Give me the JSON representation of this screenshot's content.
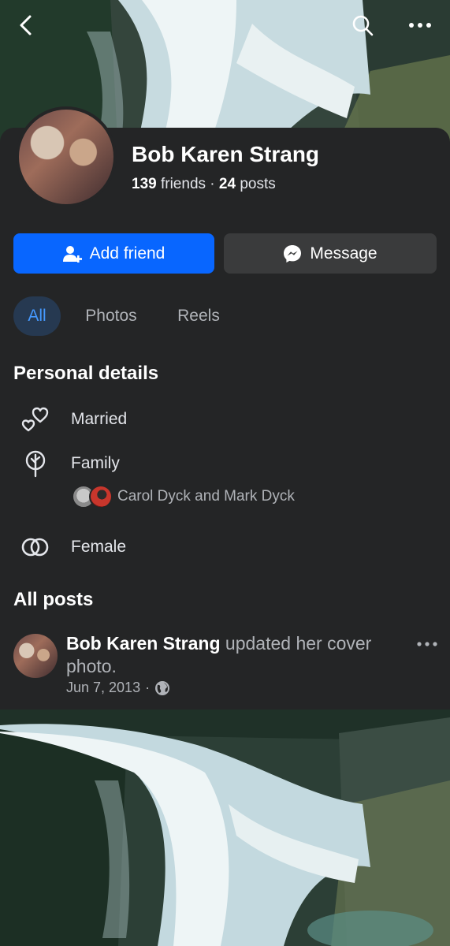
{
  "header": {
    "back_icon": "chevron-left-icon",
    "search_icon": "search-icon",
    "more_icon": "more-horizontal-icon"
  },
  "profile": {
    "name": "Bob Karen Strang",
    "friends_count": "139",
    "friends_label": "friends",
    "separator": "·",
    "posts_count": "24",
    "posts_label": "posts"
  },
  "actions": {
    "add_friend_label": "Add friend",
    "message_label": "Message",
    "add_friend_color": "#0866ff",
    "message_color": "#3a3b3c"
  },
  "tabs": [
    {
      "label": "All",
      "active": true
    },
    {
      "label": "Photos",
      "active": false
    },
    {
      "label": "Reels",
      "active": false
    }
  ],
  "personal_details": {
    "title": "Personal details",
    "items": [
      {
        "icon": "hearts-icon",
        "label": "Married"
      },
      {
        "icon": "family-tree-icon",
        "label": "Family"
      },
      {
        "icon": "gender-rings-icon",
        "label": "Female"
      }
    ],
    "family_members": "Carol Dyck and Mark Dyck"
  },
  "posts_section": {
    "title": "All posts",
    "post": {
      "author": "Bob Karen Strang",
      "action": "updated her cover photo.",
      "date": "Jun 7, 2013",
      "dot": "·",
      "privacy_icon": "globe-icon",
      "more_icon": "more-horizontal-icon"
    }
  }
}
